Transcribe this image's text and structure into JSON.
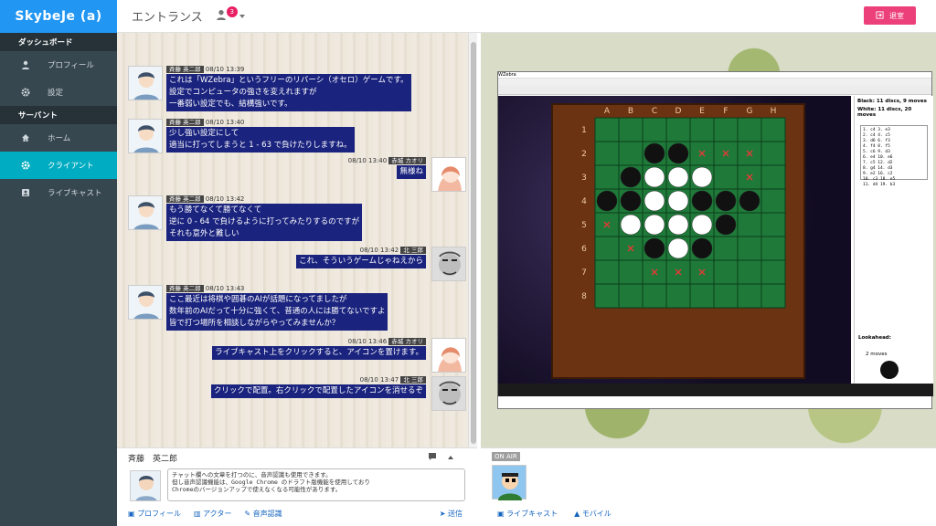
{
  "app": {
    "logo": "SkybeJe (a)",
    "title": "エントランス",
    "user_badge": "3",
    "exit_label": "退室"
  },
  "sidebar": {
    "sections": [
      {
        "label": "ダッシュボード",
        "items": [
          {
            "label": "プロフィール",
            "icon": "person-icon"
          },
          {
            "label": "設定",
            "icon": "gear-icon"
          }
        ]
      },
      {
        "label": "サーバント",
        "items": [
          {
            "label": "ホーム",
            "icon": "home-icon"
          },
          {
            "label": "クライアント",
            "icon": "gear-icon",
            "active": true
          },
          {
            "label": "ライブキャスト",
            "icon": "contact-icon"
          }
        ]
      }
    ]
  },
  "chat": {
    "messages": [
      {
        "side": "left",
        "tag": "斉藤 英二郎",
        "time": "08/10 13:39",
        "lines": [
          "これは「WZebra」というフリーのリバーシ（オセロ）ゲームです。",
          "設定でコンピュータの強さを変えれますが",
          "一番弱い設定でも、結構強いです。"
        ]
      },
      {
        "side": "left",
        "tag": "斉藤 英二郎",
        "time": "08/10 13:40",
        "lines": [
          "少し強い設定にして",
          "適当に打ってしまうと 1 - 63 で負けたりしますね。"
        ]
      },
      {
        "side": "right",
        "tag": "赤城 カオリ",
        "time": "08/10 13:40",
        "lines": [
          "無様ね"
        ]
      },
      {
        "side": "left",
        "tag": "斉藤 英二郎",
        "time": "08/10 13:42",
        "lines": [
          "もう勝てなくて勝てなくて",
          "逆に 0 - 64 で負けるように打ってみたりするのですが",
          "それも意外と難しい"
        ]
      },
      {
        "side": "right",
        "tag": "北 三郎",
        "time": "08/10 13:42",
        "lines": [
          "これ、そういうゲームじゃねえから"
        ]
      },
      {
        "side": "left",
        "tag": "斉藤 英二郎",
        "time": "08/10 13:43",
        "lines": [
          "ここ最近は将棋や囲碁のAIが話題になってましたが",
          "数年前のAIだって十分に強くて、普通の人には勝てないですよ",
          "皆で打つ場所を相談しながらやってみませんか？"
        ]
      },
      {
        "side": "right",
        "tag": "赤城 カオリ",
        "time": "08/10 13:46",
        "lines": [
          "ライブキャスト上をクリックすると、アイコンを置けます。"
        ]
      },
      {
        "side": "right",
        "tag": "北 三郎",
        "time": "08/10 13:47",
        "lines": [
          "クリックで配置。右クリックで配置したアイコンを消せるぞ"
        ]
      }
    ]
  },
  "compose": {
    "name": "斉藤　英二郎",
    "text": "チャット欄への文章を打つのに、音声認識も使用できます。\n但し音声認識機能は、Google Chrome のドラフト版機能を使用しており\nChromeのバージョンアップで使えなくなる可能性があります。",
    "profile_label": "プロフィール",
    "actor_label": "アクター",
    "voice_label": "音声認識",
    "send_label": "送信"
  },
  "live": {
    "onair_label": "ON AIR",
    "livecast_label": "ライブキャスト",
    "mobile_label": "モバイル",
    "game": {
      "window_title": "WZebra",
      "columns": [
        "A",
        "B",
        "C",
        "D",
        "E",
        "F",
        "G",
        "H"
      ],
      "rows": [
        "1",
        "2",
        "3",
        "4",
        "5",
        "6",
        "7",
        "8"
      ],
      "black_status": "Black: 11 discs, 9 moves",
      "white_status": "White: 11 discs, 20 moves",
      "lookahead_label": "Lookahead:",
      "lookahead_value": "2 moves",
      "move_list": [
        "1. c4  3. e3",
        "2. c4  4. c5",
        "3. d6  6. f3",
        "4. f4  8. f5",
        "5. c6  9. d3",
        "6. e4 10. e6",
        "7. c5 12. d2",
        "8. g4 14. d3",
        "9. e2 16. c2",
        "10. c3 18. e5",
        "11. d4 19. b3"
      ],
      "board": [
        "........",
        "..BB....",
        ".BWWW...",
        "BBWWBBB.",
        ".WWWWB..",
        "..BWB...",
        "........",
        "........"
      ],
      "marks": [
        [
          1,
          4
        ],
        [
          1,
          5
        ],
        [
          1,
          6
        ],
        [
          2,
          6
        ],
        [
          4,
          0
        ],
        [
          5,
          1
        ],
        [
          6,
          2
        ],
        [
          6,
          3
        ],
        [
          6,
          4
        ]
      ]
    }
  }
}
